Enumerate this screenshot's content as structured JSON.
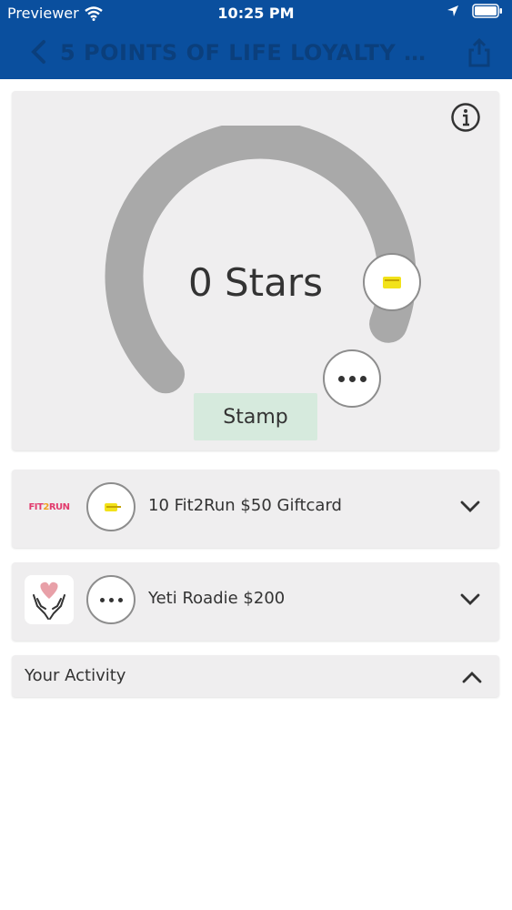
{
  "status_bar": {
    "carrier": "Previewer",
    "time": "10:25 PM"
  },
  "nav": {
    "title": "5 POINTS OF LIFE LOYALTY REW...",
    "back_icon": "chevron-left-icon",
    "share_icon": "share-icon",
    "bar_color": "#0a4f9e"
  },
  "stars_card": {
    "stars_text": "0 Stars",
    "stars_count": 0,
    "stamp_label": "Stamp",
    "info_icon": "info-icon",
    "ring_color": "#a9a9a9",
    "stamp_color": "#d6eadd"
  },
  "rewards": [
    {
      "label": "10 Fit2Run $50 Giftcard",
      "logo_text_a": "FIT",
      "logo_text_b": "2",
      "logo_text_c": "RUN",
      "icon": "gift-card-icon"
    },
    {
      "label": "Yeti Roadie $200",
      "logo": "heart-hands-icon",
      "icon": "more-dots-icon"
    }
  ],
  "activity": {
    "label": "Your Activity"
  }
}
